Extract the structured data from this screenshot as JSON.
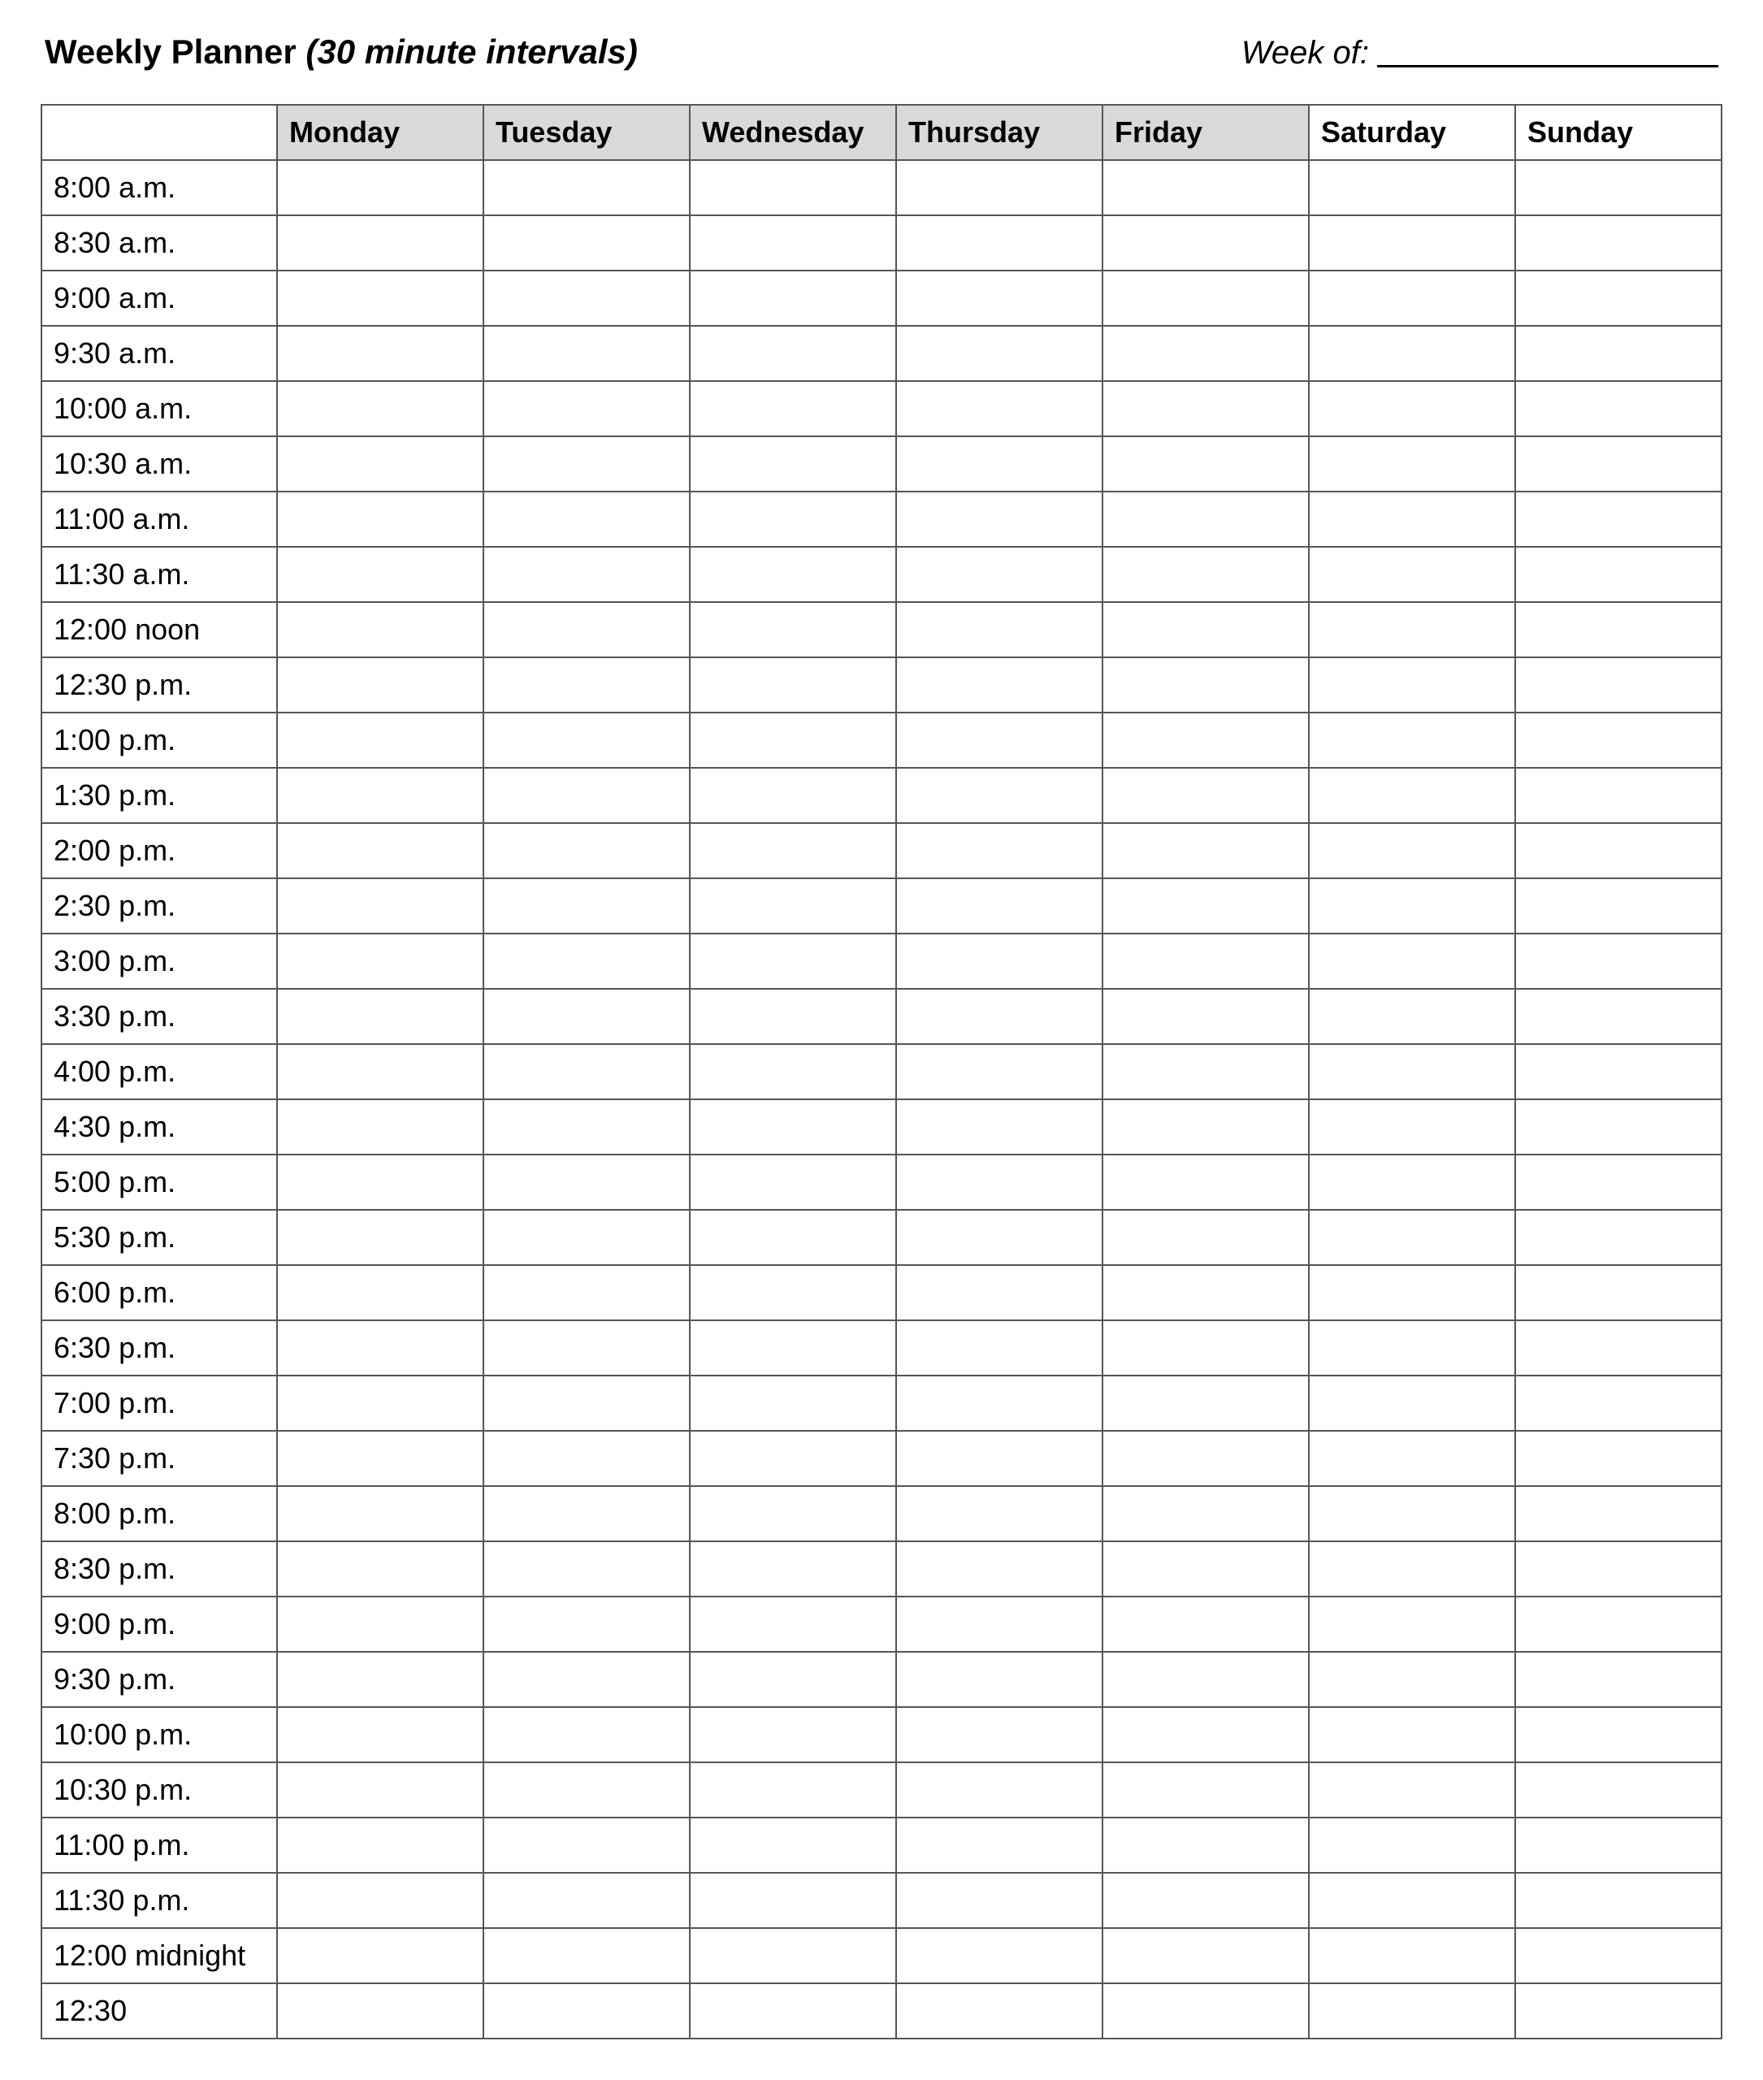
{
  "header": {
    "title_main": "Weekly Planner",
    "title_sub": "(30 minute intervals)",
    "week_of_label": "Week of:",
    "week_of_value": ""
  },
  "columns": [
    {
      "label": "Monday",
      "shaded": true
    },
    {
      "label": "Tuesday",
      "shaded": true
    },
    {
      "label": "Wednesday",
      "shaded": true
    },
    {
      "label": "Thursday",
      "shaded": true
    },
    {
      "label": "Friday",
      "shaded": true
    },
    {
      "label": "Saturday",
      "shaded": false
    },
    {
      "label": "Sunday",
      "shaded": false
    }
  ],
  "time_slots": [
    "8:00 a.m.",
    "8:30 a.m.",
    "9:00 a.m.",
    "9:30 a.m.",
    "10:00 a.m.",
    "10:30 a.m.",
    "11:00 a.m.",
    "11:30 a.m.",
    "12:00 noon",
    "12:30 p.m.",
    "1:00 p.m.",
    "1:30 p.m.",
    "2:00 p.m.",
    "2:30 p.m.",
    "3:00 p.m.",
    "3:30 p.m.",
    "4:00 p.m.",
    "4:30 p.m.",
    "5:00 p.m.",
    "5:30 p.m.",
    "6:00 p.m.",
    "6:30 p.m.",
    "7:00 p.m.",
    "7:30 p.m.",
    "8:00 p.m.",
    "8:30 p.m.",
    "9:00 p.m.",
    "9:30 p.m.",
    "10:00 p.m.",
    "10:30 p.m.",
    "11:00 p.m.",
    "11:30 p.m.",
    "12:00 midnight",
    "12:30"
  ]
}
